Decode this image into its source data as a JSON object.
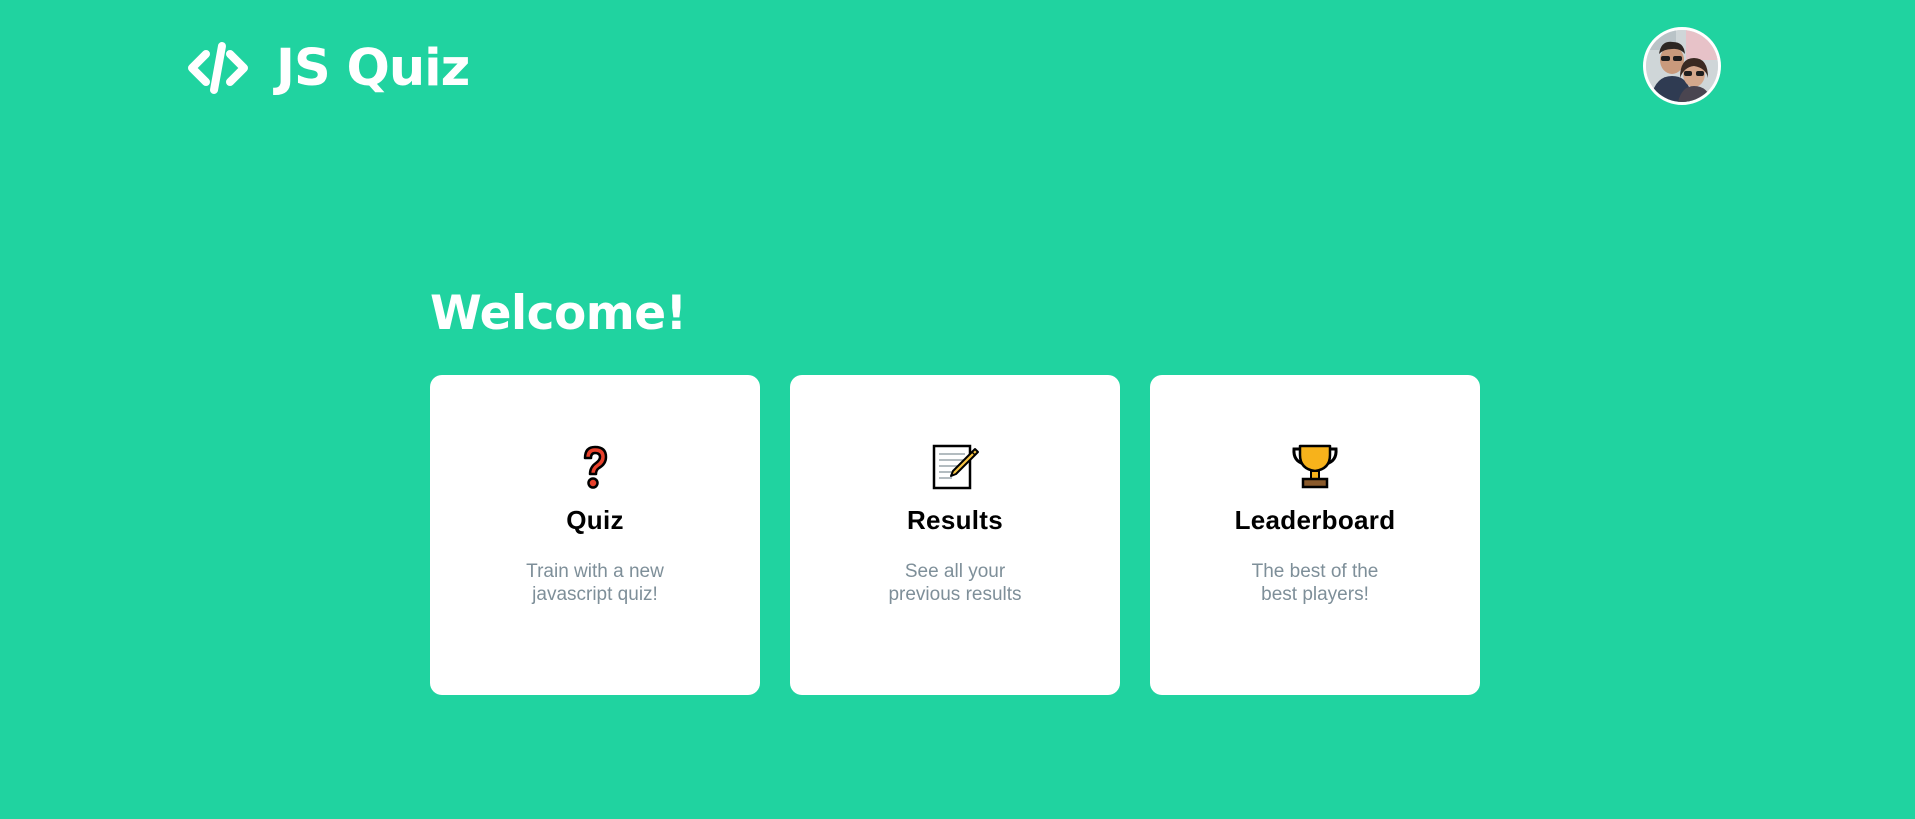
{
  "app": {
    "title": "JS Quiz",
    "logo_icon": "code-brackets-icon",
    "avatar_icon": "user-avatar-photo"
  },
  "colors": {
    "background": "#20d3a0",
    "card": "#ffffff",
    "heading": "#ffffff",
    "card_title": "#000000",
    "card_desc": "#7e8f99"
  },
  "main": {
    "welcome": "Welcome!",
    "cards": [
      {
        "icon": "question-mark-icon",
        "title": "Quiz",
        "desc_line1": "Train with a new",
        "desc_line2": "javascript quiz!"
      },
      {
        "icon": "memo-icon",
        "title": "Results",
        "desc_line1": "See all your",
        "desc_line2": "previous results"
      },
      {
        "icon": "trophy-icon",
        "title": "Leaderboard",
        "desc_line1": "The best of the",
        "desc_line2": "best players!"
      }
    ]
  }
}
